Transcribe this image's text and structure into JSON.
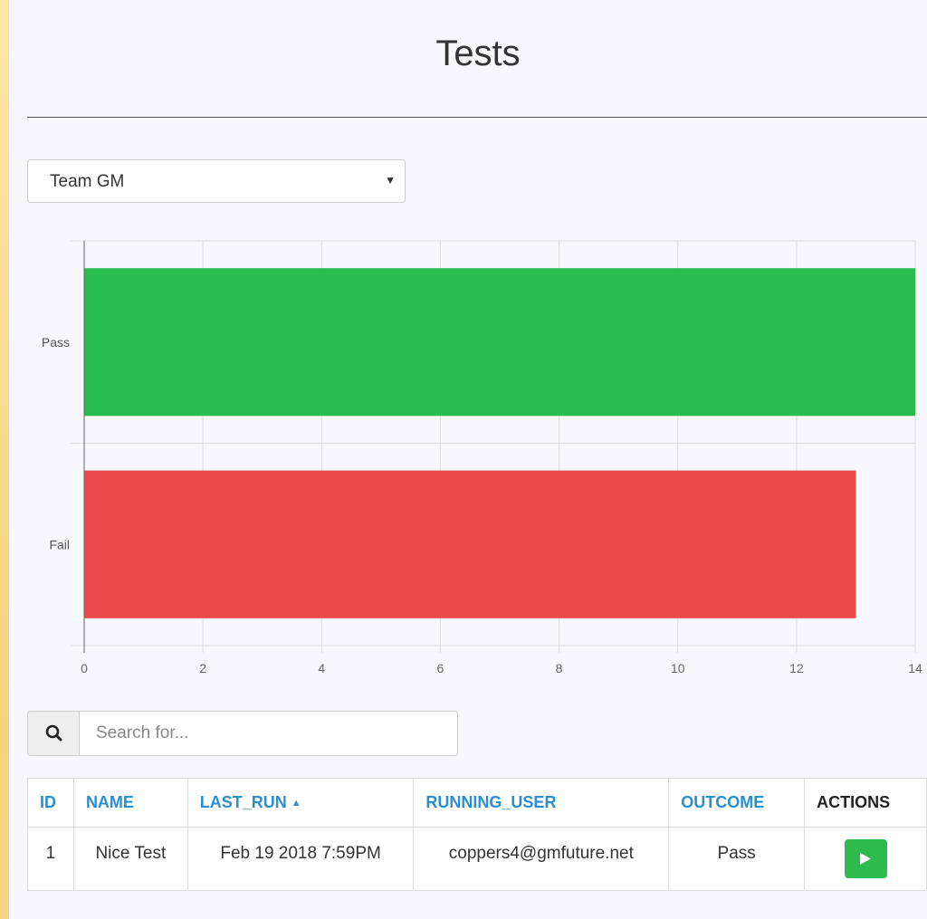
{
  "page": {
    "title": "Tests"
  },
  "team_select": {
    "value": "Team GM"
  },
  "search": {
    "placeholder": "Search for..."
  },
  "table": {
    "columns": [
      {
        "label": "ID",
        "sortable": true
      },
      {
        "label": "NAME",
        "sortable": true
      },
      {
        "label": "LAST_RUN",
        "sortable": true,
        "sort": "asc"
      },
      {
        "label": "RUNNING_USER",
        "sortable": true
      },
      {
        "label": "OUTCOME",
        "sortable": true
      },
      {
        "label": "ACTIONS",
        "sortable": false
      }
    ],
    "rows": [
      {
        "id": "1",
        "name": "Nice Test",
        "last_run": "Feb 19 2018 7:59PM",
        "running_user": "coppers4@gmfuture.net",
        "outcome": "Pass",
        "action_icon": "play-icon"
      }
    ]
  },
  "chart_data": {
    "type": "bar",
    "orientation": "horizontal",
    "categories": [
      "Pass",
      "Fail"
    ],
    "values": [
      14,
      13
    ],
    "colors": [
      "#2bbd4f",
      "#ea4a4a"
    ],
    "xlim": [
      0,
      14
    ],
    "xticks": [
      0,
      2,
      4,
      6,
      8,
      10,
      12,
      14
    ],
    "grid": true
  }
}
